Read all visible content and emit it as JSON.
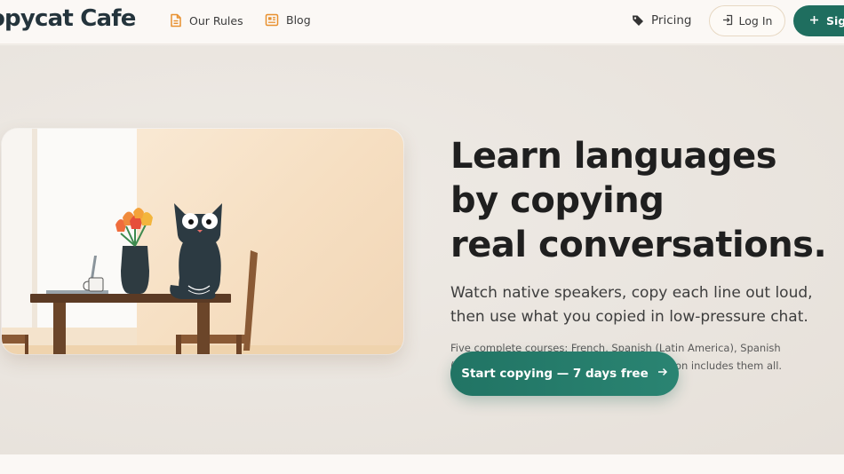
{
  "header": {
    "logo": "opycat Cafe",
    "nav": {
      "rules_label": "Our Rules",
      "blog_label": "Blog",
      "pricing_label": "Pricing"
    },
    "login_label": "Log In",
    "signup_label": "Sign",
    "icons": {
      "rules": "document-icon",
      "blog": "newspaper-icon",
      "pricing": "tag-icon",
      "login": "login-icon",
      "signup": "plus-icon"
    }
  },
  "hero": {
    "headline": [
      "Learn languages",
      "by copying",
      "real conversations."
    ],
    "subhead": [
      "Watch native speakers, copy each line out loud,",
      "then use what you copied in low-pressure chat."
    ],
    "courses": [
      "Five complete courses: French, Spanish (Latin America), Spanish",
      "(Spain), Italian, and German. One subscription includes them all."
    ],
    "cta_label": "Start copying — 7 days free",
    "cta_icon": "arrow-right-icon",
    "illustration": "cat-sitting-on-table-with-tulips-illustration"
  },
  "colors": {
    "brand": "#1f6e5f",
    "accent_orange": "#e8902e",
    "logo": "#24343c",
    "background": "#f3efea"
  }
}
